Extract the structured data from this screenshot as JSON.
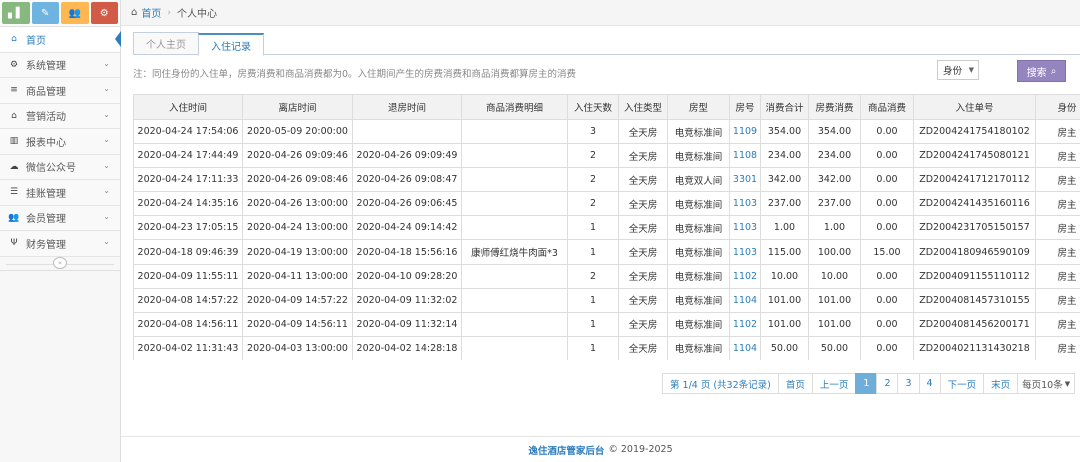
{
  "sidebar": {
    "shortcuts": [
      {
        "icon": "bar-chart-icon",
        "glyph": "▖▌",
        "color": "#87b87f"
      },
      {
        "icon": "pencil-icon",
        "glyph": "✎",
        "color": "#6fb3e0"
      },
      {
        "icon": "users-icon",
        "glyph": "👥",
        "color": "#ffb752"
      },
      {
        "icon": "cogs-icon",
        "glyph": "⚙",
        "color": "#d15b47"
      }
    ],
    "items": [
      {
        "label": "首页",
        "icon": "home-icon",
        "glyph": "⌂"
      },
      {
        "label": "系统管理",
        "icon": "gear-icon",
        "glyph": "⚙"
      },
      {
        "label": "商品管理",
        "icon": "database-icon",
        "glyph": "≡"
      },
      {
        "label": "营销活动",
        "icon": "gift-icon",
        "glyph": "⌂"
      },
      {
        "label": "报表中心",
        "icon": "bar-chart-icon",
        "glyph": "▥"
      },
      {
        "label": "微信公众号",
        "icon": "cloud-icon",
        "glyph": "☁"
      },
      {
        "label": "挂账管理",
        "icon": "list-icon",
        "glyph": "☰"
      },
      {
        "label": "会员管理",
        "icon": "group-icon",
        "glyph": "👥"
      },
      {
        "label": "财务管理",
        "icon": "cutlery-icon",
        "glyph": "Ψ"
      }
    ],
    "collapse_glyph": "«"
  },
  "breadcrumb": {
    "home": "首页",
    "current": "个人中心"
  },
  "tabs": [
    {
      "label": "个人主页",
      "active": false
    },
    {
      "label": "入住记录",
      "active": true
    }
  ],
  "note": "注：同住身份的入住单，房费消费和商品消费都为0。入住期间产生的房费消费和商品消费都算房主的消费",
  "filter": {
    "selected": "身份",
    "search_label": "搜索"
  },
  "table": {
    "headers": [
      "入住时间",
      "离店时间",
      "退房时间",
      "商品消费明细",
      "入住天数",
      "入住类型",
      "房型",
      "房号",
      "消费合计",
      "房费消费",
      "商品消费",
      "入住单号",
      "身份"
    ],
    "rows": [
      [
        "2020-04-24 17:54:06",
        "2020-05-09 20:00:00",
        "",
        "",
        "3",
        "全天房",
        "电竞标准间",
        "1109",
        "354.00",
        "354.00",
        "0.00",
        "ZD2004241754180102",
        "房主"
      ],
      [
        "2020-04-24 17:44:49",
        "2020-04-26 09:09:46",
        "2020-04-26 09:09:49",
        "",
        "2",
        "全天房",
        "电竞标准间",
        "1108",
        "234.00",
        "234.00",
        "0.00",
        "ZD2004241745080121",
        "房主"
      ],
      [
        "2020-04-24 17:11:33",
        "2020-04-26 09:08:46",
        "2020-04-26 09:08:47",
        "",
        "2",
        "全天房",
        "电竞双人间",
        "3301",
        "342.00",
        "342.00",
        "0.00",
        "ZD2004241712170112",
        "房主"
      ],
      [
        "2020-04-24 14:35:16",
        "2020-04-26 13:00:00",
        "2020-04-26 09:06:45",
        "",
        "2",
        "全天房",
        "电竞标准间",
        "1103",
        "237.00",
        "237.00",
        "0.00",
        "ZD2004241435160116",
        "房主"
      ],
      [
        "2020-04-23 17:05:15",
        "2020-04-24 13:00:00",
        "2020-04-24 09:14:42",
        "",
        "1",
        "全天房",
        "电竞标准间",
        "1103",
        "1.00",
        "1.00",
        "0.00",
        "ZD2004231705150157",
        "房主"
      ],
      [
        "2020-04-18 09:46:39",
        "2020-04-19 13:00:00",
        "2020-04-18 15:56:16",
        "康师傅红烧牛肉面*3",
        "1",
        "全天房",
        "电竞标准间",
        "1103",
        "115.00",
        "100.00",
        "15.00",
        "ZD2004180946590109",
        "房主"
      ],
      [
        "2020-04-09 11:55:11",
        "2020-04-11 13:00:00",
        "2020-04-10 09:28:20",
        "",
        "2",
        "全天房",
        "电竞标准间",
        "1102",
        "10.00",
        "10.00",
        "0.00",
        "ZD2004091155110112",
        "房主"
      ],
      [
        "2020-04-08 14:57:22",
        "2020-04-09 14:57:22",
        "2020-04-09 11:32:02",
        "",
        "1",
        "全天房",
        "电竞标准间",
        "1104",
        "101.00",
        "101.00",
        "0.00",
        "ZD2004081457310155",
        "房主"
      ],
      [
        "2020-04-08 14:56:11",
        "2020-04-09 14:56:11",
        "2020-04-09 11:32:14",
        "",
        "1",
        "全天房",
        "电竞标准间",
        "1102",
        "101.00",
        "101.00",
        "0.00",
        "ZD2004081456200171",
        "房主"
      ],
      [
        "2020-04-02 11:31:43",
        "2020-04-03 13:00:00",
        "2020-04-02 14:28:18",
        "",
        "1",
        "全天房",
        "电竞标准间",
        "1104",
        "50.00",
        "50.00",
        "0.00",
        "ZD2004021131430218",
        "房主"
      ]
    ]
  },
  "pagination": {
    "info": "第 1/4 页 (共32条记录)",
    "first": "首页",
    "prev": "上一页",
    "pages": [
      "1",
      "2",
      "3",
      "4"
    ],
    "current": "1",
    "next": "下一页",
    "last": "末页",
    "page_size": "每页10条"
  },
  "footer": {
    "brand": "逸住酒店管家后台",
    "copyright": "© 2019-2025"
  },
  "colors": {
    "accent": "#2b7dbc",
    "search_button": "#9585bf",
    "current_page": "#6faed9"
  }
}
